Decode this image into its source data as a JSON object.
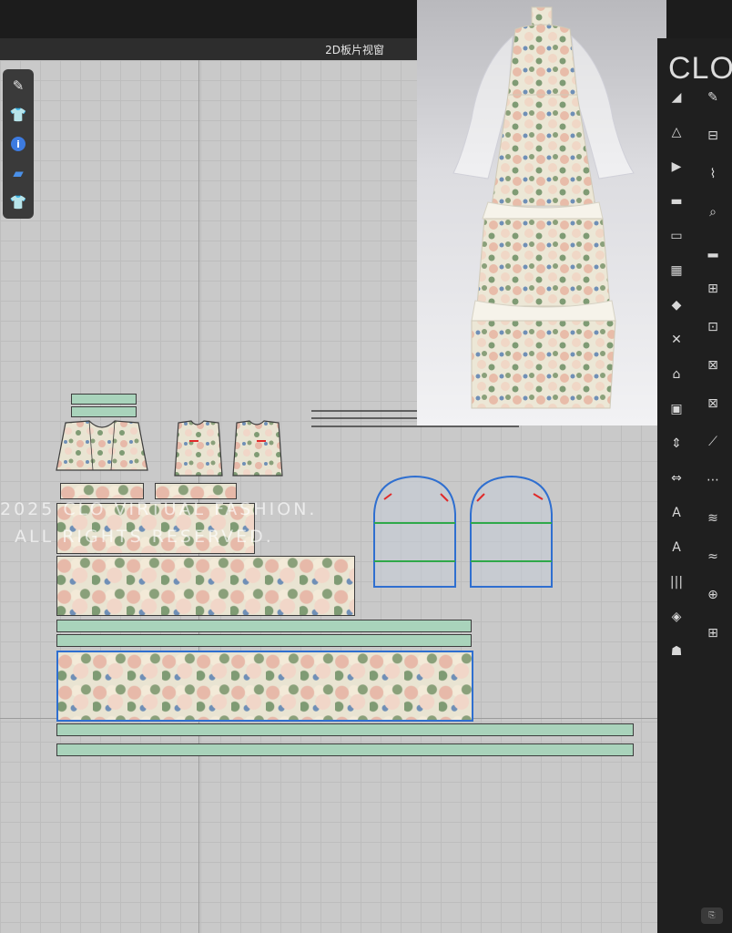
{
  "window": {
    "panel_title": "2D板片视窗"
  },
  "brand": {
    "logo_text": "CLO"
  },
  "watermark": {
    "line1": "2025 CLO VIRTUAL FASHION.",
    "line2": "ALL RIGHTS RESERVED."
  },
  "left_toolbar": {
    "items": [
      {
        "name": "edit-pattern-icon",
        "glyph": "✎"
      },
      {
        "name": "garment-icon",
        "glyph": "👕"
      },
      {
        "name": "info-icon",
        "glyph": "i"
      },
      {
        "name": "layer-icon",
        "glyph": "▰"
      },
      {
        "name": "avatar-garment-icon",
        "glyph": "👕"
      }
    ]
  },
  "right_tools": {
    "col1": [
      "◢",
      "△",
      "▶",
      "▬",
      "▭",
      "▦",
      "◆",
      "✕",
      "⌂",
      "▣",
      "⇕",
      "⇔",
      "A",
      "A",
      "|||",
      "◈",
      "☗"
    ],
    "col2": [
      "✎",
      "⊟",
      "⌇",
      "⌕",
      "▂",
      "⊞",
      "⊡",
      "⊠",
      "⊠",
      "⟋",
      "⋯",
      "≋",
      "≈",
      "⊕",
      "⊞"
    ]
  },
  "colors": {
    "pattern_outline": "#2f6fd0",
    "seam_green": "#2fa84a",
    "notch_red": "#e02a2a"
  }
}
